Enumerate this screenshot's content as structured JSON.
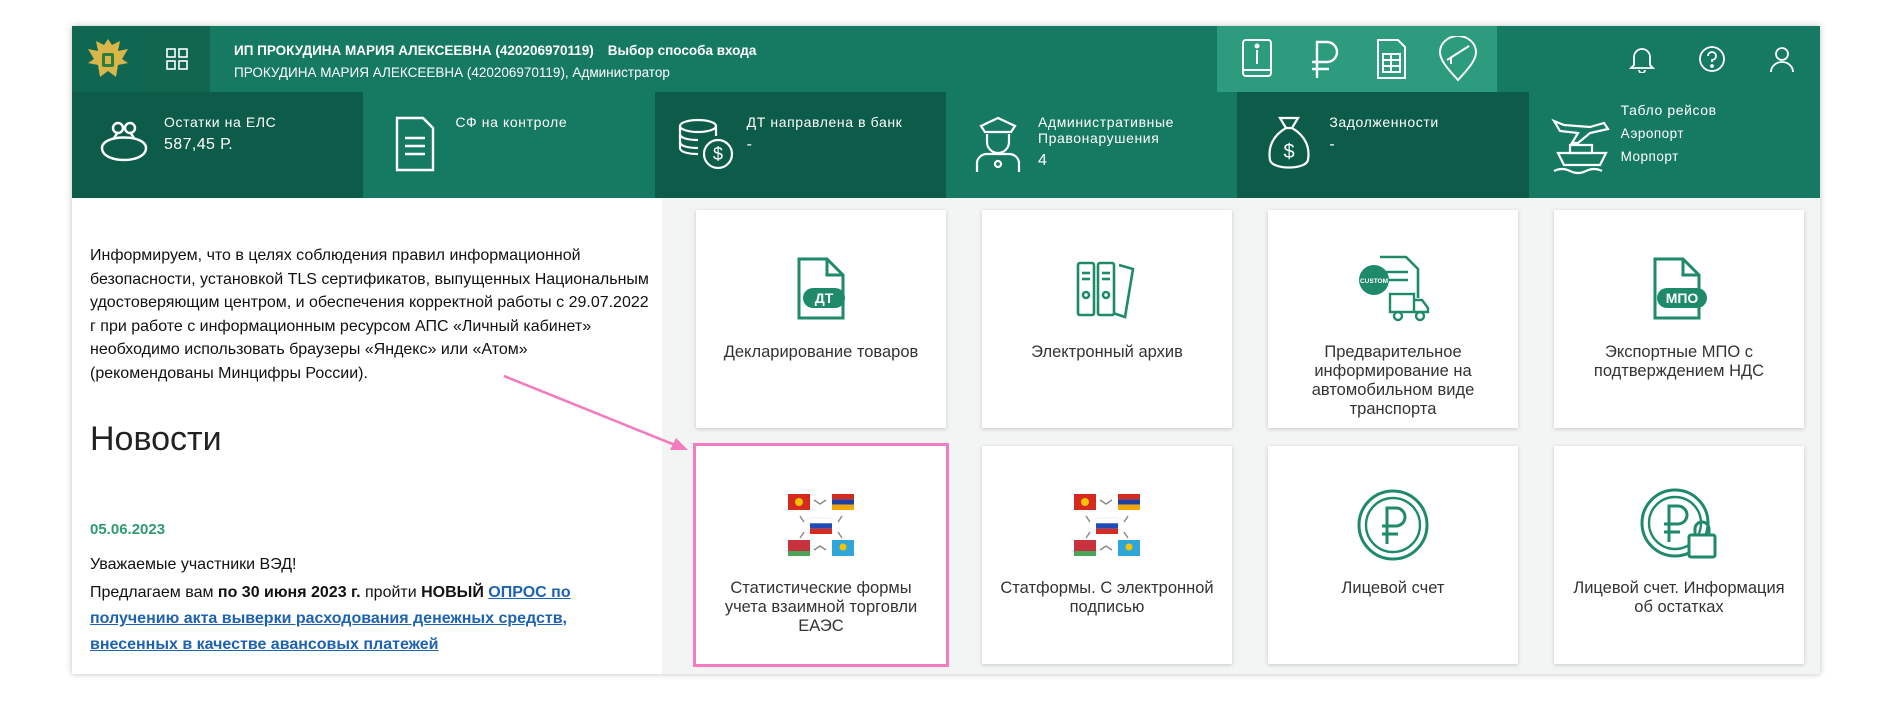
{
  "header": {
    "logo_icon": "eagle-emblem-icon",
    "apps_icon": "apps-grid-icon",
    "user_name": "ИП ПРОКУДИНА МАРИЯ АЛЕКСЕЕВНА (420206970119)",
    "login_method_link": "Выбор способа входа",
    "user_role": "ПРОКУДИНА МАРИЯ АЛЕКСЕЕВНА (420206970119), Администратор",
    "quick_icons": [
      "info-book-icon",
      "ruble-icon",
      "spreadsheet-icon",
      "map-pin-barrier-icon"
    ],
    "right_icons": [
      "bell-icon",
      "help-icon",
      "user-icon"
    ]
  },
  "stats": [
    {
      "label": "Остатки на ЕЛС",
      "value": "587,45 Р.",
      "icon": "purse-icon"
    },
    {
      "label": "СФ на контроле",
      "value": "",
      "icon": "document-icon"
    },
    {
      "label": "ДТ направлена в банк",
      "value": "-",
      "icon": "coins-icon"
    },
    {
      "label": "Административные Правонарушения",
      "value": "4",
      "icon": "officer-icon"
    },
    {
      "label": "Задолженности",
      "value": "-",
      "icon": "money-bag-icon"
    },
    {
      "label": "Табло рейсов",
      "sub1": "Аэропорт",
      "sub2": "Морпорт",
      "icon": "plane-ship-icon"
    }
  ],
  "notice": "Информируем, что в целях соблюдения правил информационной безопасности, установкой TLS сертификатов, выпущенных Национальным удостоверяющим центром, и обеспечения корректной работы с 29.07.2022 г при работе с информационным ресурсом АПС «Личный кабинет» необходимо использовать браузеры «Яндекс» или «Атом» (рекомендованы Минцифры России).",
  "news": {
    "title": "Новости",
    "date": "05.06.2023",
    "greeting": "Уважаемые участники ВЭД!",
    "body_pre": "Предлагаем вам",
    "body_deadline": "по 30 июня 2023 г.",
    "body_mid": "пройти",
    "body_new": "НОВЫЙ",
    "body_link": "ОПРОС по получению акта выверки расходования денежных средств, внесенных в качестве авансовых платежей"
  },
  "tiles": [
    {
      "label": "Декларирование товаров",
      "icon": "dt-document-icon"
    },
    {
      "label": "Электронный архив",
      "icon": "archive-binders-icon"
    },
    {
      "label": "Предварительное информирование на автомобильном виде транспорта",
      "icon": "custom-truck-icon"
    },
    {
      "label": "Экспортные МПО с подтверждением НДС",
      "icon": "mpo-document-icon"
    },
    {
      "label": "Статистические формы учета взаимной торговли ЕАЭС",
      "icon": "eaeu-flags-icon"
    },
    {
      "label": "Статформы. С электронной подписью",
      "icon": "eaeu-flags-icon"
    },
    {
      "label": "Лицевой счет",
      "icon": "ruble-circle-icon"
    },
    {
      "label": "Лицевой счет. Информация об остатках",
      "icon": "ruble-lock-icon"
    }
  ],
  "colors": {
    "header": "#167a63",
    "header_dark": "#0d5c4a",
    "accent": "#2c9b7e",
    "highlight": "#f27cbf",
    "link": "#1d62b3"
  }
}
